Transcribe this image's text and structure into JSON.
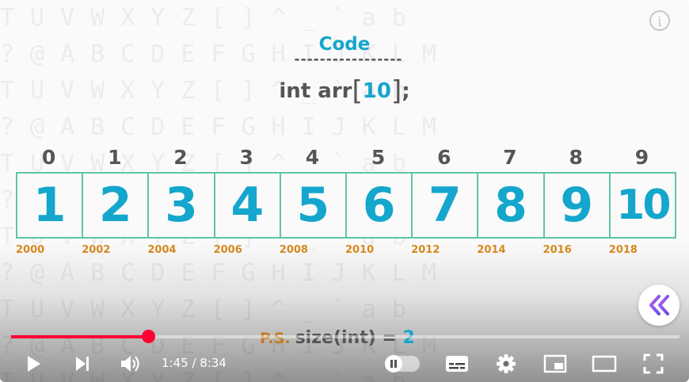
{
  "video": {
    "code_title": "Code",
    "separator": "-----------------",
    "declaration": {
      "prefix": "int arr",
      "open": "[",
      "size": "10",
      "close": "]",
      "suffix": ";"
    },
    "array": {
      "indices": [
        "0",
        "1",
        "2",
        "3",
        "4",
        "5",
        "6",
        "7",
        "8",
        "9"
      ],
      "values": [
        "1",
        "2",
        "3",
        "4",
        "5",
        "6",
        "7",
        "8",
        "9",
        "10"
      ],
      "addresses": [
        "2000",
        "2002",
        "2004",
        "2006",
        "2008",
        "2010",
        "2012",
        "2014",
        "2016",
        "2018"
      ]
    },
    "note": {
      "label": "P.S.",
      "expr_prefix": "size(int) = ",
      "expr_value": "2"
    },
    "colors": {
      "accent": "#14a6cc",
      "cell_border": "#5ec6a4",
      "address": "#d98a1e",
      "note_label": "#c57a1a"
    }
  },
  "player": {
    "time_current": "1:45",
    "time_separator": " / ",
    "time_total": "8:34",
    "progress": 0.205,
    "icons": [
      "info-icon",
      "skip-back-icon",
      "play-icon",
      "next-icon",
      "volume-icon",
      "autoplay-toggle",
      "subtitles-icon",
      "settings-icon",
      "miniplayer-icon",
      "theater-icon",
      "fullscreen-icon"
    ],
    "colors": {
      "progress": "#ff0033"
    }
  }
}
